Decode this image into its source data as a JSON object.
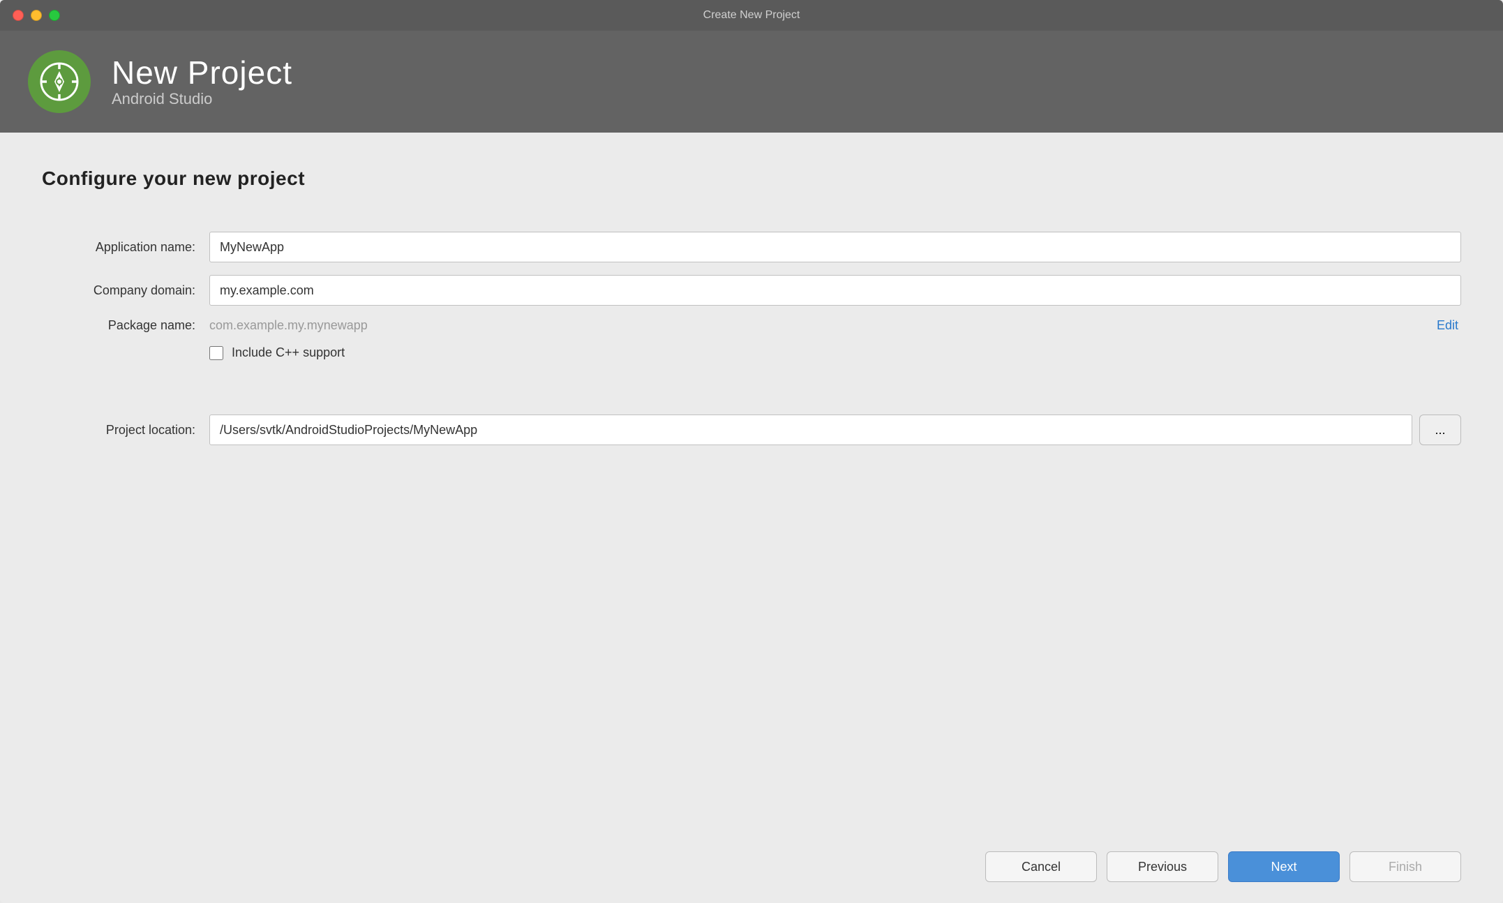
{
  "window": {
    "title": "Create New Project"
  },
  "header": {
    "title": "New Project",
    "subtitle": "Android Studio"
  },
  "form": {
    "page_title": "Configure your new project",
    "application_name_label": "Application name:",
    "application_name_value": "MyNewApp",
    "company_domain_label": "Company domain:",
    "company_domain_value": "my.example.com",
    "package_name_label": "Package name:",
    "package_name_value": "com.example.my.mynewapp",
    "edit_label": "Edit",
    "cpp_support_label": "Include C++ support",
    "project_location_label": "Project location:",
    "project_location_value": "/Users/svtk/AndroidStudioProjects/MyNewApp",
    "browse_button_label": "..."
  },
  "footer": {
    "cancel_label": "Cancel",
    "previous_label": "Previous",
    "next_label": "Next",
    "finish_label": "Finish"
  },
  "traffic_lights": {
    "close": "close",
    "minimize": "minimize",
    "maximize": "maximize"
  }
}
